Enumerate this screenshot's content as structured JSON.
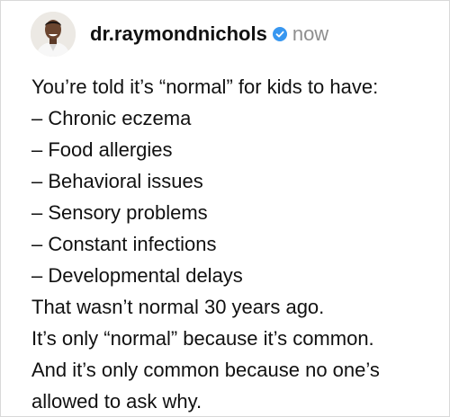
{
  "post": {
    "username": "dr.raymondnichols",
    "timestamp": "now",
    "verified_color": "#3897f0",
    "avatar_icon": "profile-photo",
    "verified_icon": "verified-badge-icon",
    "lines": [
      "You’re told it’s “normal” for kids to have:",
      "– Chronic eczema",
      "– Food allergies",
      "– Behavioral issues",
      "– Sensory problems",
      "– Constant infections",
      "– Developmental delays",
      "That wasn’t normal 30 years ago.",
      "It’s only “normal” because it’s common.",
      "And it’s only common because no one’s",
      "allowed to ask why."
    ]
  }
}
